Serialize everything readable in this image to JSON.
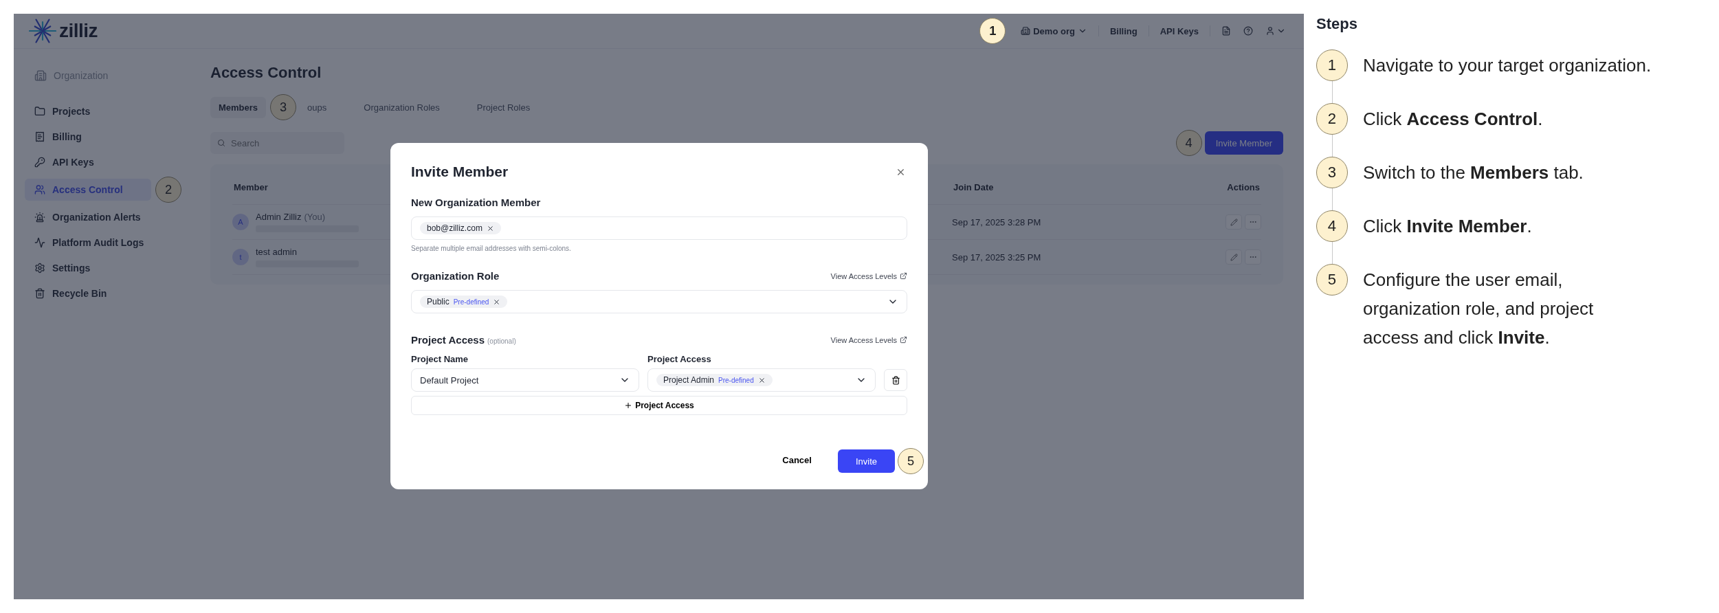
{
  "top_bar": {
    "logo": "zilliz",
    "org_switcher": {
      "label": "Demo org",
      "callout": "1"
    },
    "links": [
      "Billing",
      "API Keys"
    ]
  },
  "sidebar": {
    "section": "Organization",
    "items": [
      {
        "label": "Projects",
        "selected": false
      },
      {
        "label": "Billing",
        "selected": false
      },
      {
        "label": "API Keys",
        "selected": false
      },
      {
        "label": "Access Control",
        "selected": true,
        "callout": "2"
      },
      {
        "label": "Organization Alerts",
        "selected": false
      },
      {
        "label": "Platform Audit Logs",
        "selected": false
      },
      {
        "label": "Settings",
        "selected": false
      },
      {
        "label": "Recycle Bin",
        "selected": false
      }
    ]
  },
  "page": {
    "title": "Access Control",
    "tabs": [
      {
        "label": "Members",
        "selected": true,
        "callout": "3"
      },
      {
        "label": "oups",
        "selected": false
      },
      {
        "label": "Organization Roles",
        "selected": false
      },
      {
        "label": "Project Roles",
        "selected": false
      }
    ],
    "search": {
      "placeholder": "Search"
    },
    "invite_button": {
      "label": "Invite Member",
      "callout": "4"
    },
    "table": {
      "columns": [
        "Member",
        "Join Date",
        "Actions"
      ],
      "rows": [
        {
          "avatar": "A",
          "name": "Admin Zilliz",
          "suffix": "(You)",
          "join_date": "Sep 17, 2025 3:28 PM"
        },
        {
          "avatar": "t",
          "name": "test admin",
          "join_date": "Sep 17, 2025 3:25 PM"
        }
      ]
    }
  },
  "modal": {
    "title": "Invite Member",
    "member_label": "New Organization Member",
    "emails": [
      "bob@zilliz.com"
    ],
    "member_help": "Separate multiple email addresses with semi-colons.",
    "role_label": "Organization Role",
    "role_link": "View Access Levels",
    "role_chips": [
      {
        "label": "Public",
        "tag": "Pre-defined"
      }
    ],
    "access_label": "Project Access",
    "access_hint": "(optional)",
    "access_link": "View Access Levels",
    "project_name_label": "Project Name",
    "project_access_label": "Project Access",
    "project_name": "Default Project",
    "project_access_chips": [
      {
        "label": "Project Admin",
        "tag": "Pre-defined"
      }
    ],
    "add_button": "Project Access",
    "cancel": "Cancel",
    "invite": {
      "label": "Invite",
      "callout": "5"
    }
  },
  "steps": {
    "title": "Steps",
    "items": [
      {
        "number": "1",
        "text": "Navigate to your target organization."
      },
      {
        "number": "2",
        "text": "Click **Access Control**."
      },
      {
        "number": "3",
        "text": "Switch to the **Members** tab."
      },
      {
        "number": "4",
        "text": "Click **Invite Member**."
      },
      {
        "number": "5",
        "text": "Configure the user email, organization role, and project access and click **Invite**."
      }
    ]
  }
}
